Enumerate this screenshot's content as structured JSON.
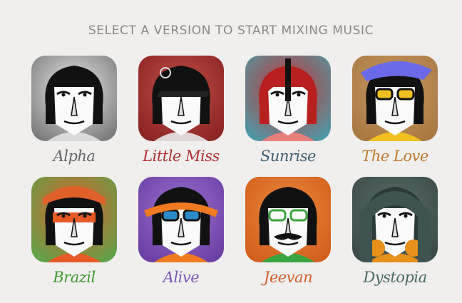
{
  "heading": "SELECT A VERSION TO START MIXING MUSIC",
  "versions": [
    {
      "name": "Alpha",
      "color": "#666666",
      "bg": "#7a7a7a",
      "bg2": "#e8e8e8",
      "hat": "none",
      "hair": "#111111",
      "accent": "#d9d9d9",
      "icon": "alpha-character-icon"
    },
    {
      "name": "Little Miss",
      "color": "#b03030",
      "bg": "#8a2323",
      "bg2": "#c0504a",
      "hat": "cap",
      "hair": "#111111",
      "accent": "#e0d6d6",
      "icon": "little-miss-character-icon"
    },
    {
      "name": "Sunrise",
      "color": "#3f5f70",
      "bg": "#4d9aa8",
      "bg2": "#c83030",
      "hat": "helmet",
      "hair": "#b82020",
      "accent": "#e8807a",
      "icon": "sunrise-character-icon"
    },
    {
      "name": "The Love",
      "color": "#c27a2e",
      "bg": "#a87843",
      "bg2": "#c89a60",
      "hat": "visor",
      "hair": "#111111",
      "accent": "#f0c020",
      "icon": "the-love-character-icon"
    },
    {
      "name": "Brazil",
      "color": "#3d9a2e",
      "bg": "#5ea24a",
      "bg2": "#e0602a",
      "hat": "band",
      "hair": "#111111",
      "accent": "#e85a25",
      "icon": "brazil-character-icon"
    },
    {
      "name": "Alive",
      "color": "#7a55b5",
      "bg": "#6a3fa3",
      "bg2": "#9a70d0",
      "hat": "goggles",
      "hair": "#111111",
      "accent": "#f07a20",
      "icon": "alive-character-icon"
    },
    {
      "name": "Jeevan",
      "color": "#d0602a",
      "bg": "#d25e1e",
      "bg2": "#e88a3a",
      "hat": "none",
      "hair": "#111111",
      "accent": "#3aa540",
      "icon": "jeevan-character-icon"
    },
    {
      "name": "Dystopia",
      "color": "#4a6a60",
      "bg": "#3a4a48",
      "bg2": "#5a6e68",
      "hat": "hood",
      "hair": "#2a3a38",
      "accent": "#e8901a",
      "icon": "dystopia-character-icon"
    }
  ]
}
